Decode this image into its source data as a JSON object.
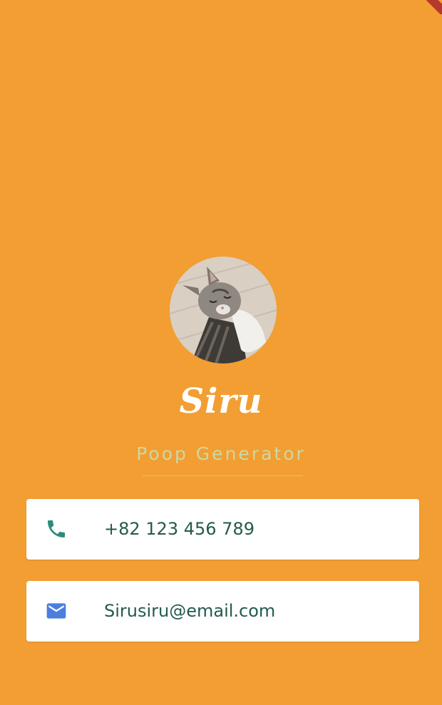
{
  "profile": {
    "name": "Siru",
    "tagline": "Poop Generator",
    "avatar_subject": "tabby cat lying on its back"
  },
  "contacts": [
    {
      "type": "phone",
      "icon": "phone-icon",
      "value": "+82 123 456 789",
      "icon_color": "#2E8B7C"
    },
    {
      "type": "email",
      "icon": "email-icon",
      "value": "Sirusiru@email.com",
      "icon_color": "#4A7FE0"
    }
  ],
  "colors": {
    "background": "#F29E33",
    "name": "#FFFFFF",
    "tagline": "#CBD8A7",
    "card_text": "#245A4E",
    "debug_banner": "#B5382D"
  }
}
